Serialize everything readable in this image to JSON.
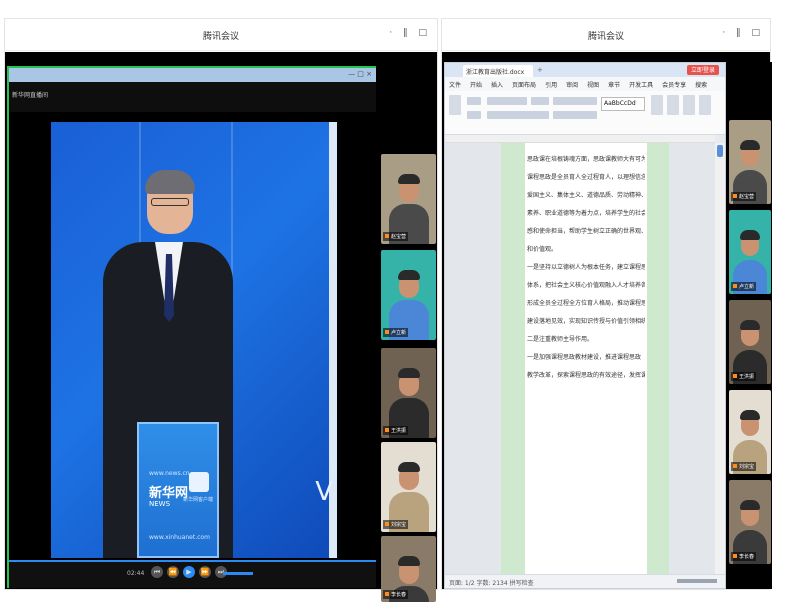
{
  "left_window": {
    "title": "腾讯会议",
    "controls": "· ‖ □",
    "player": {
      "bar_controls": "— □ ×",
      "title": "新华网直播间",
      "time": "02:44",
      "buttons": [
        "⏮",
        "⏪",
        "▶",
        "⏩",
        "⏭"
      ]
    },
    "broadcast": {
      "podium_url": "www.news.cn",
      "podium_brand": "新华网",
      "podium_tag": "NEWS",
      "podium_sub": "新华网客户端",
      "podium_bottom": "www.xinhuanet.com",
      "screen_text": "V"
    },
    "participants": [
      "赵宝营",
      "卢立新",
      "王洪振",
      "刘宗宝",
      "李长春"
    ]
  },
  "right_window": {
    "title": "腾讯会议",
    "controls": "· ‖ □",
    "doc": {
      "tabs": [
        "浙江教育出版社.docx"
      ],
      "new_tab": "+",
      "login_label": "立即登录",
      "menu": [
        "文件",
        "开始",
        "插入",
        "页面布局",
        "引用",
        "审阅",
        "视图",
        "章节",
        "开发工具",
        "会员专享",
        "搜索"
      ],
      "style_label": "AaBbCcDd",
      "paragraphs": [
        "思政课在培根铸魂方面，思政课教师大有可为。",
        "课程思政是全员育人全过程育人，以理想信念、",
        "爱国主义、集体主义、道德品质、劳动精神、文化",
        "素养、职业道德等为着力点，培养学生的社会责任",
        "感和使命担当，帮助学生树立正确的世界观、人生观",
        "和价值观。",
        "一是坚持以立德树人为根本任务，建立课程思政",
        "体系，把社会主义核心价值观融入人才培养各环节，",
        "形成全员全过程全方位育人格局，推动课程思政",
        "建设落地见效，实现知识传授与价值引领相统一。",
        "二是注重教师主导作用。",
        "",
        "一是加强课程思政教材建设，推进课程思政",
        "教学改革，探索课程思政的有效途径，发挥课程育"
      ],
      "status": "页面: 1/2  字数: 2134  拼写检查"
    },
    "participants": [
      "赵宝营",
      "卢立新",
      "王洪振",
      "刘宗宝",
      "李长春"
    ]
  },
  "colors": {
    "active_speaker_border": "#27c54d",
    "stage_blue": "#1e73e4",
    "accent_blue": "#2a8cf2",
    "doc_margin_green": "#cfe9cf",
    "login_red": "#e5534b"
  }
}
